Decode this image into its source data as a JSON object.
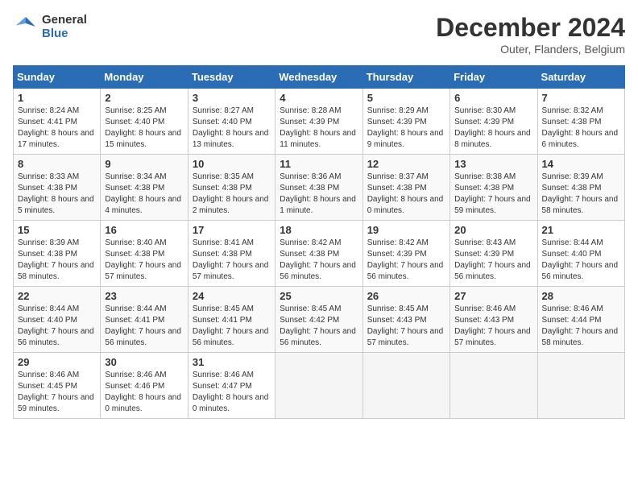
{
  "header": {
    "logo_line1": "General",
    "logo_line2": "Blue",
    "month": "December 2024",
    "location": "Outer, Flanders, Belgium"
  },
  "weekdays": [
    "Sunday",
    "Monday",
    "Tuesday",
    "Wednesday",
    "Thursday",
    "Friday",
    "Saturday"
  ],
  "weeks": [
    [
      {
        "day": "1",
        "info": "Sunrise: 8:24 AM\nSunset: 4:41 PM\nDaylight: 8 hours and 17 minutes."
      },
      {
        "day": "2",
        "info": "Sunrise: 8:25 AM\nSunset: 4:40 PM\nDaylight: 8 hours and 15 minutes."
      },
      {
        "day": "3",
        "info": "Sunrise: 8:27 AM\nSunset: 4:40 PM\nDaylight: 8 hours and 13 minutes."
      },
      {
        "day": "4",
        "info": "Sunrise: 8:28 AM\nSunset: 4:39 PM\nDaylight: 8 hours and 11 minutes."
      },
      {
        "day": "5",
        "info": "Sunrise: 8:29 AM\nSunset: 4:39 PM\nDaylight: 8 hours and 9 minutes."
      },
      {
        "day": "6",
        "info": "Sunrise: 8:30 AM\nSunset: 4:39 PM\nDaylight: 8 hours and 8 minutes."
      },
      {
        "day": "7",
        "info": "Sunrise: 8:32 AM\nSunset: 4:38 PM\nDaylight: 8 hours and 6 minutes."
      }
    ],
    [
      {
        "day": "8",
        "info": "Sunrise: 8:33 AM\nSunset: 4:38 PM\nDaylight: 8 hours and 5 minutes."
      },
      {
        "day": "9",
        "info": "Sunrise: 8:34 AM\nSunset: 4:38 PM\nDaylight: 8 hours and 4 minutes."
      },
      {
        "day": "10",
        "info": "Sunrise: 8:35 AM\nSunset: 4:38 PM\nDaylight: 8 hours and 2 minutes."
      },
      {
        "day": "11",
        "info": "Sunrise: 8:36 AM\nSunset: 4:38 PM\nDaylight: 8 hours and 1 minute."
      },
      {
        "day": "12",
        "info": "Sunrise: 8:37 AM\nSunset: 4:38 PM\nDaylight: 8 hours and 0 minutes."
      },
      {
        "day": "13",
        "info": "Sunrise: 8:38 AM\nSunset: 4:38 PM\nDaylight: 7 hours and 59 minutes."
      },
      {
        "day": "14",
        "info": "Sunrise: 8:39 AM\nSunset: 4:38 PM\nDaylight: 7 hours and 58 minutes."
      }
    ],
    [
      {
        "day": "15",
        "info": "Sunrise: 8:39 AM\nSunset: 4:38 PM\nDaylight: 7 hours and 58 minutes."
      },
      {
        "day": "16",
        "info": "Sunrise: 8:40 AM\nSunset: 4:38 PM\nDaylight: 7 hours and 57 minutes."
      },
      {
        "day": "17",
        "info": "Sunrise: 8:41 AM\nSunset: 4:38 PM\nDaylight: 7 hours and 57 minutes."
      },
      {
        "day": "18",
        "info": "Sunrise: 8:42 AM\nSunset: 4:38 PM\nDaylight: 7 hours and 56 minutes."
      },
      {
        "day": "19",
        "info": "Sunrise: 8:42 AM\nSunset: 4:39 PM\nDaylight: 7 hours and 56 minutes."
      },
      {
        "day": "20",
        "info": "Sunrise: 8:43 AM\nSunset: 4:39 PM\nDaylight: 7 hours and 56 minutes."
      },
      {
        "day": "21",
        "info": "Sunrise: 8:44 AM\nSunset: 4:40 PM\nDaylight: 7 hours and 56 minutes."
      }
    ],
    [
      {
        "day": "22",
        "info": "Sunrise: 8:44 AM\nSunset: 4:40 PM\nDaylight: 7 hours and 56 minutes."
      },
      {
        "day": "23",
        "info": "Sunrise: 8:44 AM\nSunset: 4:41 PM\nDaylight: 7 hours and 56 minutes."
      },
      {
        "day": "24",
        "info": "Sunrise: 8:45 AM\nSunset: 4:41 PM\nDaylight: 7 hours and 56 minutes."
      },
      {
        "day": "25",
        "info": "Sunrise: 8:45 AM\nSunset: 4:42 PM\nDaylight: 7 hours and 56 minutes."
      },
      {
        "day": "26",
        "info": "Sunrise: 8:45 AM\nSunset: 4:43 PM\nDaylight: 7 hours and 57 minutes."
      },
      {
        "day": "27",
        "info": "Sunrise: 8:46 AM\nSunset: 4:43 PM\nDaylight: 7 hours and 57 minutes."
      },
      {
        "day": "28",
        "info": "Sunrise: 8:46 AM\nSunset: 4:44 PM\nDaylight: 7 hours and 58 minutes."
      }
    ],
    [
      {
        "day": "29",
        "info": "Sunrise: 8:46 AM\nSunset: 4:45 PM\nDaylight: 7 hours and 59 minutes."
      },
      {
        "day": "30",
        "info": "Sunrise: 8:46 AM\nSunset: 4:46 PM\nDaylight: 8 hours and 0 minutes."
      },
      {
        "day": "31",
        "info": "Sunrise: 8:46 AM\nSunset: 4:47 PM\nDaylight: 8 hours and 0 minutes."
      },
      null,
      null,
      null,
      null
    ]
  ]
}
